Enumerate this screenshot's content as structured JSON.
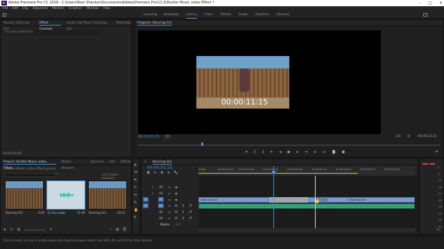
{
  "titlebar": {
    "app_icon": "Pr",
    "title": "Adobe Premiere Pro CC 2018 - C:\\Users\\Ravi Shankar\\Documents\\Adobe\\Premiere Pro\\12.0\\Stutter Music video Effect *"
  },
  "menu": [
    "File",
    "Edit",
    "Clip",
    "Sequence",
    "Markers",
    "Graphics",
    "Window",
    "Help"
  ],
  "workspaces": [
    "Learning",
    "Assembly",
    "Editing",
    "Color",
    "Effects",
    "Audio",
    "Graphics",
    "Libraries"
  ],
  "left_panel": {
    "tabs": [
      "Source: Dancing Girl",
      "Effect Controls",
      "Audio Clip Mixer: Dancing Girl",
      "Metadata"
    ],
    "content": "(no clips selected)",
    "timecode": "00;00;00;00"
  },
  "program": {
    "tab": "Program: Dancing Girl",
    "overlay_timecode": "00:00:11:15",
    "current_tc": "00;00;01;15",
    "fit": "Fit",
    "quality": "1/4",
    "duration_tc": "00;00;22;15"
  },
  "project": {
    "tabs": [
      "Project: Stutter Music video Effect",
      "Media Browser",
      "Libraries",
      "Info",
      "Effects"
    ],
    "filename": "Stutter Music video Effect.prproj",
    "items_selected": "1 of 3 items selected",
    "items": [
      {
        "name": "Dancing Girl",
        "duration": "4:05"
      },
      {
        "name": "11 Sec Loops",
        "duration": "11:09"
      },
      {
        "name": "Dancing Girl",
        "duration": "20:12"
      }
    ]
  },
  "timeline": {
    "tab": "Dancing Girl",
    "timecode": "00;00;01;15",
    "ruler": [
      "00;00",
      "00;00;00;15",
      "00;00;01;00",
      "00;00;01;15",
      "00;00;02;00",
      "00;00;02;15",
      "00;00;03;00",
      "00;00;03;15",
      "00;00;04;00"
    ],
    "video_tracks": [
      "V3",
      "V2",
      "V1"
    ],
    "audio_tracks": [
      "A1",
      "A2",
      "A3"
    ],
    "master": {
      "label": "Master",
      "value": "0.0"
    },
    "clips": [
      {
        "name": "Dancing Girl",
        "track": "V1"
      },
      {
        "name": "Dancing Girl",
        "track": "V1"
      }
    ]
  },
  "meters": {
    "values": [
      "0",
      "-6",
      "-12",
      "-18",
      "-24",
      "-30",
      "-36",
      "-42",
      "-48",
      "-54"
    ],
    "unit": "dB"
  },
  "status": "Click to select, or click in empty space and drag to marquee select. Use Shift, Alt, and Ctrl for other options.",
  "colors": {
    "accent": "#4a90d9",
    "clip_video": "#6f8fbf",
    "clip_audio": "#2e8a6a",
    "playhead": "#4a90d9"
  }
}
